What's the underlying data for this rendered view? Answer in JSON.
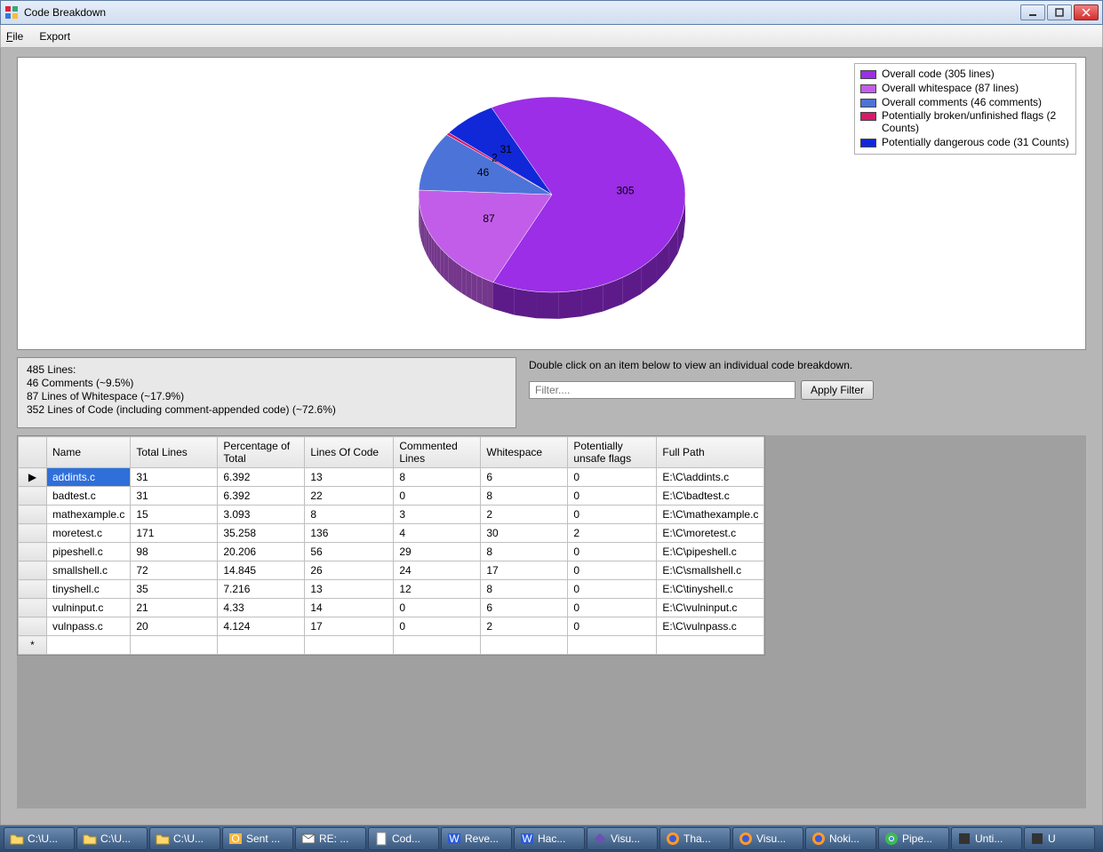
{
  "window": {
    "title": "Code Breakdown"
  },
  "menu": {
    "file": "File",
    "file_ul": "F",
    "file_rest": "ile",
    "export": "Export"
  },
  "chart_data": {
    "type": "pie",
    "title": "",
    "slices": [
      {
        "name": "Overall code (305 lines)",
        "value": 305,
        "color": "#9b2ee6"
      },
      {
        "name": "Overall whitespace (87 lines)",
        "value": 87,
        "color": "#c25dea"
      },
      {
        "name": "Overall comments (46 comments)",
        "value": 46,
        "color": "#4c73d8"
      },
      {
        "name": "Potentially broken/unfinished flags (2 Counts)",
        "value": 2,
        "color": "#d61a6a"
      },
      {
        "name": "Potentially dangerous code (31 Counts)",
        "value": 31,
        "color": "#1028d8"
      }
    ]
  },
  "legend": [
    {
      "label": "Overall code (305 lines)",
      "color": "#9b2ee6"
    },
    {
      "label": "Overall whitespace (87 lines)",
      "color": "#c25dea"
    },
    {
      "label": "Overall comments (46 comments)",
      "color": "#4c73d8"
    },
    {
      "label": "Potentially broken/unfinished flags (2 Counts)",
      "color": "#d61a6a"
    },
    {
      "label": "Potentially dangerous code (31 Counts)",
      "color": "#1028d8"
    }
  ],
  "stats": {
    "l1": "485 Lines:",
    "l2": "46 Comments (~9.5%)",
    "l3": "87 Lines of Whitespace (~17.9%)",
    "l4": "352 Lines of Code (including comment-appended code) (~72.6%)"
  },
  "filter": {
    "hint": "Double click on an item below to view an individual code breakdown.",
    "placeholder": "Filter....",
    "apply": "Apply Filter"
  },
  "grid": {
    "headers": [
      "Name",
      "Total Lines",
      "Percentage of Total",
      "Lines Of Code",
      "Commented Lines",
      "Whitespace",
      "Potentially unsafe flags",
      "Full Path"
    ],
    "rows": [
      {
        "name": "addints.c",
        "total": "31",
        "pct": "6.392",
        "loc": "13",
        "cmt": "8",
        "ws": "6",
        "flags": "0",
        "path": "E:\\C\\addints.c",
        "selected": true
      },
      {
        "name": "badtest.c",
        "total": "31",
        "pct": "6.392",
        "loc": "22",
        "cmt": "0",
        "ws": "8",
        "flags": "0",
        "path": "E:\\C\\badtest.c"
      },
      {
        "name": "mathexample.c",
        "total": "15",
        "pct": "3.093",
        "loc": "8",
        "cmt": "3",
        "ws": "2",
        "flags": "0",
        "path": "E:\\C\\mathexample.c"
      },
      {
        "name": "moretest.c",
        "total": "171",
        "pct": "35.258",
        "loc": "136",
        "cmt": "4",
        "ws": "30",
        "flags": "2",
        "path": "E:\\C\\moretest.c"
      },
      {
        "name": "pipeshell.c",
        "total": "98",
        "pct": "20.206",
        "loc": "56",
        "cmt": "29",
        "ws": "8",
        "flags": "0",
        "path": "E:\\C\\pipeshell.c"
      },
      {
        "name": "smallshell.c",
        "total": "72",
        "pct": "14.845",
        "loc": "26",
        "cmt": "24",
        "ws": "17",
        "flags": "0",
        "path": "E:\\C\\smallshell.c"
      },
      {
        "name": "tinyshell.c",
        "total": "35",
        "pct": "7.216",
        "loc": "13",
        "cmt": "12",
        "ws": "8",
        "flags": "0",
        "path": "E:\\C\\tinyshell.c"
      },
      {
        "name": "vulninput.c",
        "total": "21",
        "pct": "4.33",
        "loc": "14",
        "cmt": "0",
        "ws": "6",
        "flags": "0",
        "path": "E:\\C\\vulninput.c"
      },
      {
        "name": "vulnpass.c",
        "total": "20",
        "pct": "4.124",
        "loc": "17",
        "cmt": "0",
        "ws": "2",
        "flags": "0",
        "path": "E:\\C\\vulnpass.c"
      }
    ]
  },
  "taskbar": [
    {
      "label": "C:\\U...",
      "icon": "folder"
    },
    {
      "label": "C:\\U...",
      "icon": "folder"
    },
    {
      "label": "C:\\U...",
      "icon": "folder"
    },
    {
      "label": "Sent ...",
      "icon": "outlook"
    },
    {
      "label": "RE: ...",
      "icon": "mail"
    },
    {
      "label": "Cod...",
      "icon": "doc"
    },
    {
      "label": "Reve...",
      "icon": "word"
    },
    {
      "label": "Hac...",
      "icon": "word"
    },
    {
      "label": "Visu...",
      "icon": "vs"
    },
    {
      "label": "Tha...",
      "icon": "firefox"
    },
    {
      "label": "Visu...",
      "icon": "firefox"
    },
    {
      "label": "Noki...",
      "icon": "firefox"
    },
    {
      "label": "Pipe...",
      "icon": "chrome"
    },
    {
      "label": "Unti...",
      "icon": "app"
    },
    {
      "label": "U",
      "icon": "app"
    }
  ]
}
